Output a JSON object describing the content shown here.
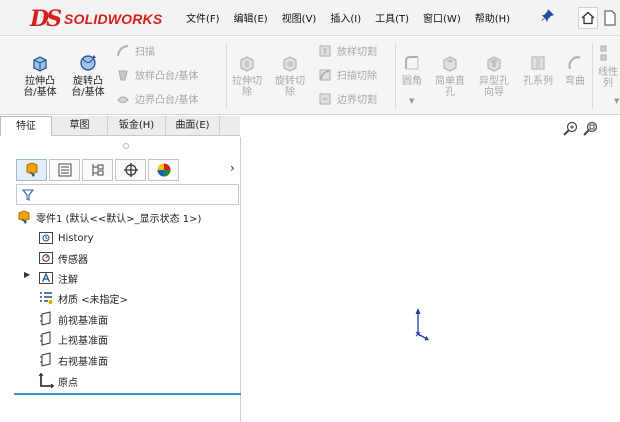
{
  "app": {
    "logo_mark": "DS",
    "logo_text": "SOLIDWORKS",
    "brand_color": "#d6201d"
  },
  "menu": {
    "items": [
      "文件(F)",
      "编辑(E)",
      "视图(V)",
      "插入(I)",
      "工具(T)",
      "窗口(W)",
      "帮助(H)"
    ]
  },
  "ribbon": {
    "extrude_boss": "拉伸凸\n台/基体",
    "revolve_boss": "旋转凸\n台/基体",
    "sweep": "扫描",
    "loft_boss": "放样凸台/基体",
    "boundary_boss": "边界凸台/基体",
    "extrude_cut": "拉伸切\n除",
    "revolve_cut": "旋转切\n除",
    "loft_cut": "放样切割",
    "sweep_cut": "扫描切除",
    "boundary_cut": "边界切割",
    "fillet": "圆角",
    "simple_hole": "简单直\n孔",
    "hole_wizard": "异型孔\n向导",
    "hole_series": "孔系列",
    "flex": "弯曲",
    "linear_pattern": "线性\n列"
  },
  "command_tabs": [
    "特征",
    "草图",
    "钣金(H)",
    "曲面(E)"
  ],
  "feature_tree": {
    "part": "零件1 (默认<<默认>_显示状态 1>)",
    "items": [
      "History",
      "传感器",
      "注解",
      "材质 <未指定>",
      "前视基准面",
      "上视基准面",
      "右视基准面",
      "原点"
    ]
  },
  "icons": {
    "pin": "pin-icon",
    "home": "home-icon",
    "filter": "filter-icon",
    "zoom_fit": "zoom-to-fit-icon",
    "zoom_area": "zoom-area-icon"
  }
}
